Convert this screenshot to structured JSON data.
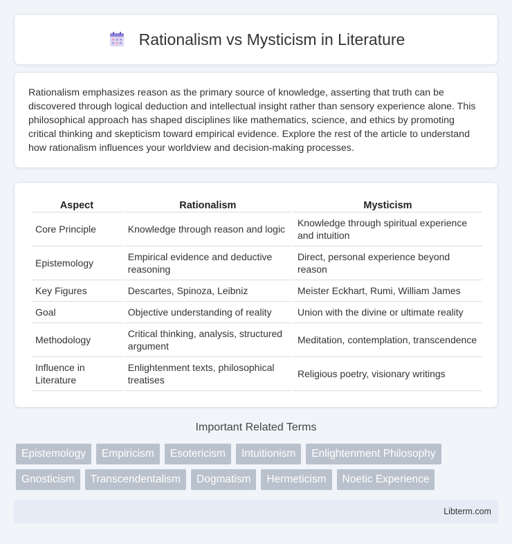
{
  "header": {
    "title": "Rationalism vs Mysticism in Literature",
    "icon": "calendar-icon"
  },
  "intro": {
    "text": "Rationalism emphasizes reason as the primary source of knowledge, asserting that truth can be discovered through logical deduction and intellectual insight rather than sensory experience alone. This philosophical approach has shaped disciplines like mathematics, science, and ethics by promoting critical thinking and skepticism toward empirical evidence. Explore the rest of the article to understand how rationalism influences your worldview and decision-making processes."
  },
  "table": {
    "headers": [
      "Aspect",
      "Rationalism",
      "Mysticism"
    ],
    "rows": [
      [
        "Core Principle",
        "Knowledge through reason and logic",
        "Knowledge through spiritual experience and intuition"
      ],
      [
        "Epistemology",
        "Empirical evidence and deductive reasoning",
        "Direct, personal experience beyond reason"
      ],
      [
        "Key Figures",
        "Descartes, Spinoza, Leibniz",
        "Meister Eckhart, Rumi, William James"
      ],
      [
        "Goal",
        "Objective understanding of reality",
        "Union with the divine or ultimate reality"
      ],
      [
        "Methodology",
        "Critical thinking, analysis, structured argument",
        "Meditation, contemplation, transcendence"
      ],
      [
        "Influence in Literature",
        "Enlightenment texts, philosophical treatises",
        "Religious poetry, visionary writings"
      ]
    ]
  },
  "related": {
    "title": "Important Related Terms",
    "row1": [
      "Epistemology",
      "Empiricism",
      "Esotericism",
      "Intuitionism",
      "Enlightenment Philosophy"
    ],
    "row2": [
      "Gnosticism",
      "Transcendentalism",
      "Dogmatism",
      "Hermeticism",
      "Noetic Experience"
    ]
  },
  "footer": {
    "site": "Libterm.com"
  },
  "colors": {
    "background": "#f1f4f9",
    "tag": "#b9c1cc",
    "footer": "#e6ecf5"
  }
}
